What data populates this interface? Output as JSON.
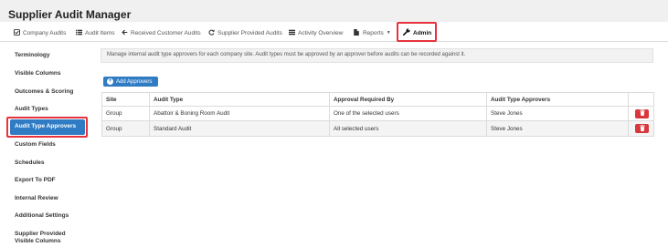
{
  "app": {
    "title": "Supplier Audit Manager"
  },
  "nav": {
    "items": [
      {
        "label": "Company Audits",
        "icon": "check-square-icon"
      },
      {
        "label": "Audit Items",
        "icon": "list-icon"
      },
      {
        "label": "Received Customer Audits",
        "icon": "arrow-left-icon"
      },
      {
        "label": "Supplier Provided Audits",
        "icon": "refresh-icon"
      },
      {
        "label": "Activity Overview",
        "icon": "table-icon"
      },
      {
        "label": "Reports",
        "icon": "file-icon"
      },
      {
        "label": "Admin",
        "icon": "wrench-icon"
      }
    ],
    "active": "Admin"
  },
  "sidebar": {
    "items": [
      {
        "label": "Terminology"
      },
      {
        "label": "Visible Columns"
      },
      {
        "label": "Outcomes & Scoring"
      },
      {
        "label": "Audit Types"
      },
      {
        "label": "Audit Type Approvers"
      },
      {
        "label": "Custom Fields"
      },
      {
        "label": "Schedules"
      },
      {
        "label": "Export To PDF"
      },
      {
        "label": "Internal Review"
      },
      {
        "label": "Additional Settings"
      },
      {
        "label": "Supplier Provided",
        "label2": "Visible Columns"
      }
    ],
    "active": "Audit Type Approvers"
  },
  "main": {
    "info": "Manage internal audit type approvers for each company site. Audit types must be approved by an approver before audits can be recorded against it.",
    "add_button": "Add Approvers",
    "table": {
      "columns": [
        "Site",
        "Audit Type",
        "Approval Required By",
        "Audit Type Approvers"
      ],
      "rows": [
        {
          "site": "Group",
          "audit_type": "Abattoir & Boning Room Audit",
          "approval": "One of the selected users",
          "approvers": "Steve Jones"
        },
        {
          "site": "Group",
          "audit_type": "Standard Audit",
          "approval": "All selected users",
          "approvers": "Steve Jones"
        }
      ]
    }
  },
  "colors": {
    "primary": "#2f7cc4",
    "danger": "#d9363e",
    "highlight": "#e8323c"
  }
}
